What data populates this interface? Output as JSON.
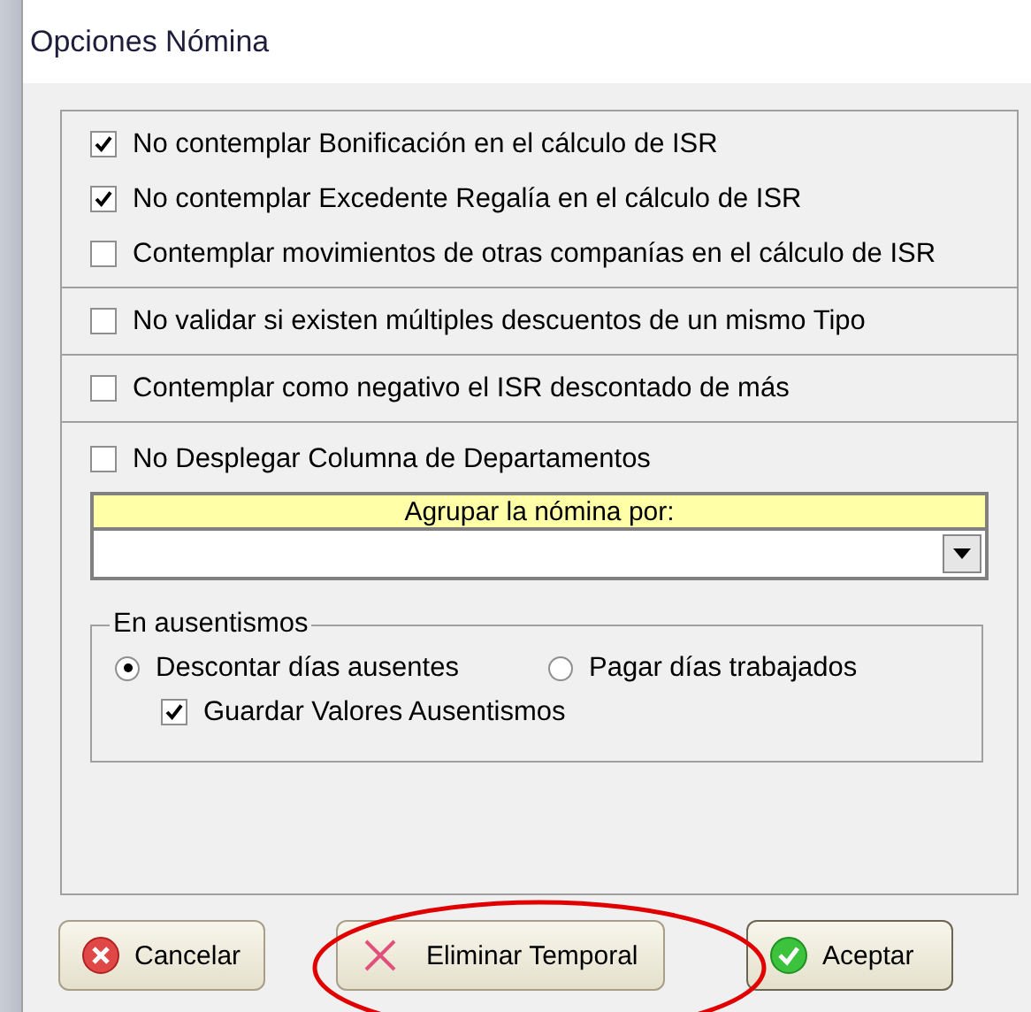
{
  "window": {
    "title": "Opciones Nómina"
  },
  "sections": [
    {
      "items": [
        {
          "kind": "checkbox",
          "label": "No contemplar Bonificación en el cálculo de ISR",
          "checked": true
        },
        {
          "kind": "checkbox",
          "label": "No contemplar Excedente Regalía en el cálculo de ISR",
          "checked": true
        },
        {
          "kind": "checkbox",
          "label": "Contemplar movimientos de otras companías en el cálculo de ISR",
          "checked": false
        }
      ]
    },
    {
      "items": [
        {
          "kind": "checkbox",
          "label": "No validar si existen múltiples descuentos de un mismo Tipo",
          "checked": false
        }
      ]
    },
    {
      "items": [
        {
          "kind": "checkbox",
          "label": "Contemplar como negativo el ISR descontado de más",
          "checked": false
        }
      ]
    },
    {
      "items": [
        {
          "kind": "checkbox",
          "label": "No Desplegar Columna de Departamentos",
          "checked": false
        },
        {
          "kind": "combo",
          "label": "Agrupar la nómina por:"
        },
        {
          "kind": "group",
          "title": "En ausentismos",
          "radios": [
            {
              "label": "Descontar días ausentes",
              "selected": true
            },
            {
              "label": "Pagar días trabajados",
              "selected": false
            }
          ],
          "checkbox": {
            "label": "Guardar Valores Ausentismos",
            "checked": true
          }
        }
      ]
    }
  ],
  "buttons": [
    {
      "kind": "cancel",
      "label": "Cancelar",
      "highlighted": false
    },
    {
      "kind": "delete",
      "label": "Eliminar Temporal",
      "highlighted": true
    },
    {
      "kind": "accept",
      "label": "Aceptar",
      "highlighted": false
    }
  ]
}
